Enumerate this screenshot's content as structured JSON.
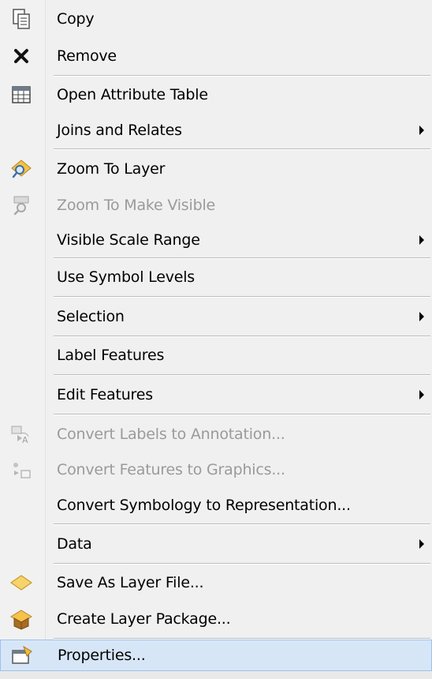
{
  "menu": {
    "items": [
      {
        "label": "Copy",
        "icon": "copy-icon",
        "disabled": false,
        "submenu": false
      },
      {
        "label": "Remove",
        "icon": "remove-icon",
        "disabled": false,
        "submenu": false
      },
      {
        "label": "Open Attribute Table",
        "icon": "attribute-table-icon",
        "disabled": false,
        "submenu": false
      },
      {
        "label": "Joins and Relates",
        "icon": "",
        "disabled": false,
        "submenu": true
      },
      {
        "label": "Zoom To Layer",
        "icon": "zoom-to-layer-icon",
        "disabled": false,
        "submenu": false
      },
      {
        "label": "Zoom To Make Visible",
        "icon": "zoom-to-make-visible-icon",
        "disabled": true,
        "submenu": false
      },
      {
        "label": "Visible Scale Range",
        "icon": "",
        "disabled": false,
        "submenu": true
      },
      {
        "label": "Use Symbol Levels",
        "icon": "",
        "disabled": false,
        "submenu": false
      },
      {
        "label": "Selection",
        "icon": "",
        "disabled": false,
        "submenu": true
      },
      {
        "label": "Label Features",
        "icon": "",
        "disabled": false,
        "submenu": false
      },
      {
        "label": "Edit Features",
        "icon": "",
        "disabled": false,
        "submenu": true
      },
      {
        "label": "Convert Labels to Annotation...",
        "icon": "convert-labels-icon",
        "disabled": true,
        "submenu": false
      },
      {
        "label": "Convert Features to Graphics...",
        "icon": "convert-features-icon",
        "disabled": true,
        "submenu": false
      },
      {
        "label": "Convert Symbology to Representation...",
        "icon": "",
        "disabled": false,
        "submenu": false
      },
      {
        "label": "Data",
        "icon": "",
        "disabled": false,
        "submenu": true
      },
      {
        "label": "Save As Layer File...",
        "icon": "layer-file-icon",
        "disabled": false,
        "submenu": false
      },
      {
        "label": "Create Layer Package...",
        "icon": "layer-package-icon",
        "disabled": false,
        "submenu": false
      },
      {
        "label": "Properties...",
        "icon": "properties-icon",
        "disabled": false,
        "submenu": false,
        "selected": true
      }
    ]
  },
  "colors": {
    "menu_background": "#f0f0f0",
    "selection_background": "#d7e6f7",
    "selection_border": "#9cc1ec",
    "disabled_text": "#9a9a9a"
  }
}
